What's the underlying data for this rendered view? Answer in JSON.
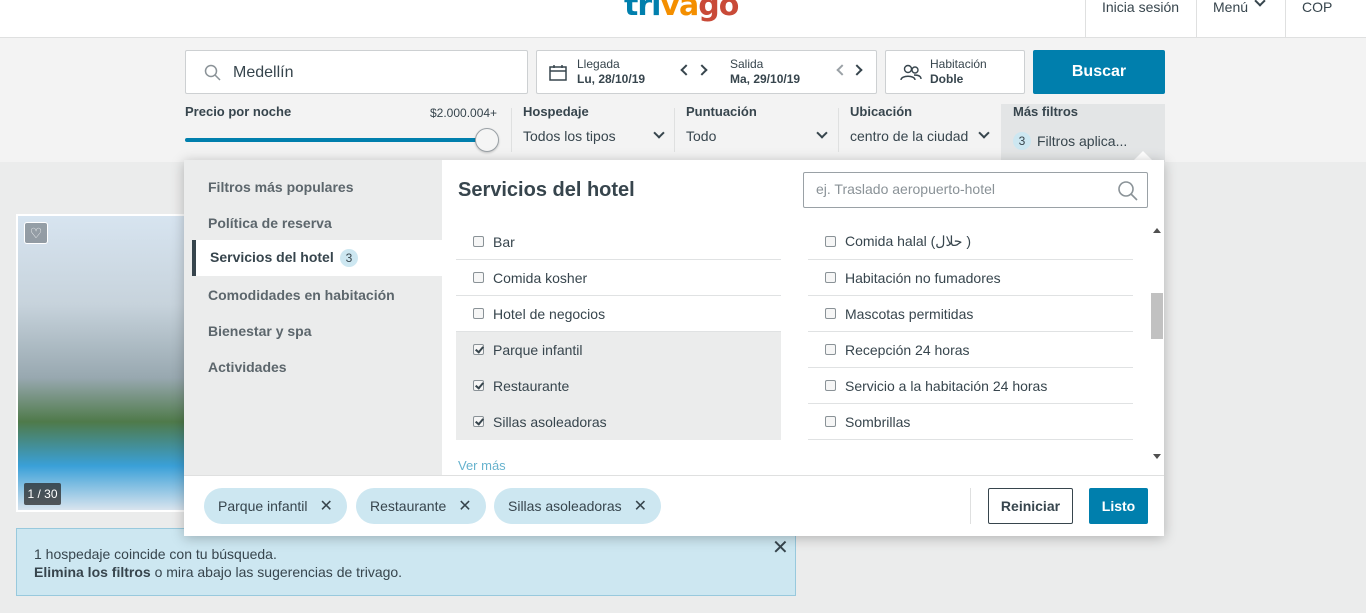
{
  "header": {
    "logo_parts": [
      "tri",
      "va",
      "go"
    ],
    "login": "Inicia sesión",
    "menu": "Menú",
    "currency": "COP"
  },
  "search": {
    "destination": "Medellín",
    "checkin_label": "Llegada",
    "checkin_value": "Lu, 28/10/19",
    "checkout_label": "Salida",
    "checkout_value": "Ma, 29/10/19",
    "room_label": "Habitación",
    "room_value": "Doble",
    "search_button": "Buscar"
  },
  "filters": {
    "price_label": "Precio por noche",
    "price_value": "$2.000.004+",
    "price_level_fraction": 1.0,
    "lodging_label": "Hospedaje",
    "lodging_value": "Todos los tipos",
    "rating_label": "Puntuación",
    "rating_value": "Todo",
    "location_label": "Ubicación",
    "location_value": "centro de la ciudad",
    "more_label": "Más filtros",
    "more_count": "3",
    "more_value": "Filtros aplica..."
  },
  "panel": {
    "side_items": [
      "Filtros más populares",
      "Política de reserva",
      "Servicios del hotel",
      "Comodidades en habitación",
      "Bienestar y spa",
      "Actividades"
    ],
    "active_count": "3",
    "title": "Servicios del hotel",
    "search_placeholder": "ej. Traslado aeropuerto-hotel",
    "left_options": [
      {
        "label": "Bar",
        "checked": false
      },
      {
        "label": "Comida kosher",
        "checked": false
      },
      {
        "label": "Hotel de negocios",
        "checked": false
      },
      {
        "label": "Parque infantil",
        "checked": true
      },
      {
        "label": "Restaurante",
        "checked": true
      },
      {
        "label": "Sillas asoleadoras",
        "checked": true
      }
    ],
    "right_options": [
      {
        "label": "Comida halal (حلال )",
        "checked": false
      },
      {
        "label": "Habitación no fumadores",
        "checked": false
      },
      {
        "label": "Mascotas permitidas",
        "checked": false
      },
      {
        "label": "Recepción 24 horas",
        "checked": false
      },
      {
        "label": "Servicio a la habitación 24 horas",
        "checked": false
      },
      {
        "label": "Sombrillas",
        "checked": false
      }
    ],
    "see_more": "Ver más",
    "chips": [
      "Parque infantil",
      "Restaurante",
      "Sillas asoleadoras"
    ],
    "chip_remove": "✕",
    "reset_button": "Reiniciar",
    "done_button": "Listo"
  },
  "listing": {
    "image_count": "1 / 30"
  },
  "notice": {
    "line1": "1 hospedaje coincide con tu búsqueda.",
    "line2_bold": "Elimina los filtros",
    "line2_rest": " o mira abajo las sugerencias de trivago.",
    "close": "✕"
  },
  "colors": {
    "accent": "#007fad",
    "chip_bg": "#cde7f1",
    "text": "#37454d"
  }
}
